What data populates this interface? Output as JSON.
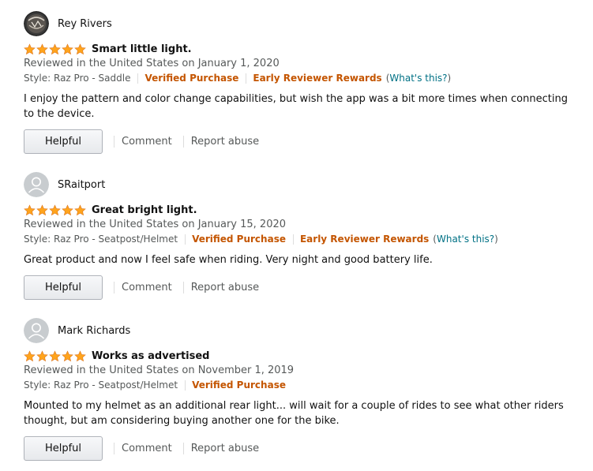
{
  "colors": {
    "star": "#ffa41c",
    "verified": "#c45500",
    "link": "#007185",
    "muted": "#565959"
  },
  "reviews": [
    {
      "reviewer": "Rey Rivers",
      "avatar": "custom-photo",
      "rating": 5,
      "title": "Smart little light.",
      "date": "Reviewed in the United States on January 1, 2020",
      "style": "Style: Raz Pro - Saddle",
      "verified": "Verified Purchase",
      "early_reviewer": "Early Reviewer Rewards",
      "whats_this": "What's this?",
      "body": "I enjoy the pattern and color change capabilities, but wish the app was a bit more times when connecting to the device.",
      "helpful_label": "Helpful",
      "comment_label": "Comment",
      "report_label": "Report abuse"
    },
    {
      "reviewer": "SRaitport",
      "avatar": "default-avatar",
      "rating": 5,
      "title": "Great bright light.",
      "date": "Reviewed in the United States on January 15, 2020",
      "style": "Style: Raz Pro - Seatpost/Helmet",
      "verified": "Verified Purchase",
      "early_reviewer": "Early Reviewer Rewards",
      "whats_this": "What's this?",
      "body": "Great product and now I feel safe when riding. Very night and good battery life.",
      "helpful_label": "Helpful",
      "comment_label": "Comment",
      "report_label": "Report abuse"
    },
    {
      "reviewer": "Mark Richards",
      "avatar": "default-avatar",
      "rating": 5,
      "title": "Works as advertised",
      "date": "Reviewed in the United States on November 1, 2019",
      "style": "Style: Raz Pro - Seatpost/Helmet",
      "verified": "Verified Purchase",
      "body": "Mounted to my helmet as an additional rear light... will wait for a couple of rides to see what other riders thought, but am considering buying another one for the bike.",
      "helpful_label": "Helpful",
      "comment_label": "Comment",
      "report_label": "Report abuse"
    }
  ]
}
